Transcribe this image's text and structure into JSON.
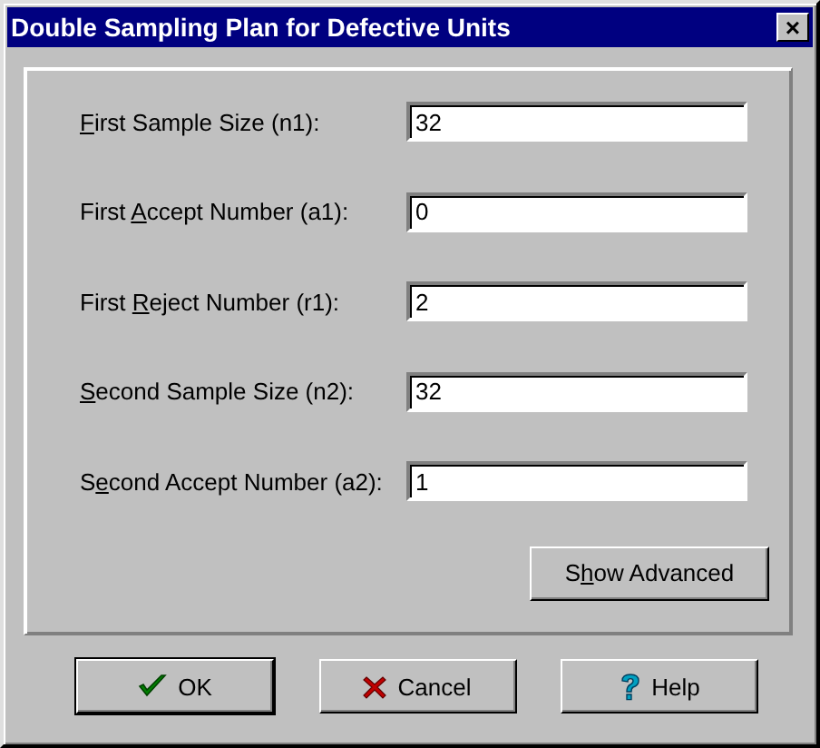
{
  "window": {
    "title": "Double Sampling Plan for Defective Units",
    "close_button": "×"
  },
  "fields": [
    {
      "label_key": "F",
      "label_after": "irst Sample Size (n1):",
      "value": "32"
    },
    {
      "label_before": "First ",
      "label_key": "A",
      "label_after": "ccept Number (a1):",
      "value": "0"
    },
    {
      "label_before": "First ",
      "label_key": "R",
      "label_after": "eject Number (r1):",
      "value": "2"
    },
    {
      "label_key": "S",
      "label_after": "econd Sample Size (n2):",
      "value": "32"
    },
    {
      "label_before": "S",
      "label_key": "e",
      "label_after": "cond Accept Number (a2):",
      "value": "1"
    }
  ],
  "advanced_button": {
    "label_before": "S",
    "label_key": "h",
    "label_after": "ow Advanced"
  },
  "buttons": [
    {
      "kind": "ok",
      "label": "OK",
      "default": true
    },
    {
      "kind": "cancel",
      "label": "Cancel",
      "default": false
    },
    {
      "kind": "help",
      "label": "Help",
      "default": false
    }
  ]
}
